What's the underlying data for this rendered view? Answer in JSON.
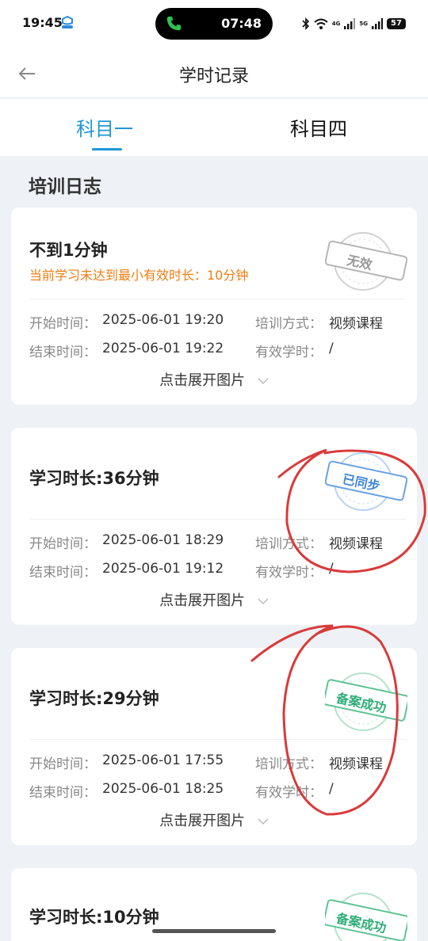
{
  "status_bar": {
    "time": "19:45",
    "call_timer": "07:48",
    "network_1": "4G",
    "network_2": "5G",
    "battery": "57"
  },
  "nav": {
    "title": "学时记录",
    "back_icon": "arrow-left-icon"
  },
  "tabs": [
    {
      "label": "科目一",
      "active": true
    },
    {
      "label": "科目四",
      "active": false
    }
  ],
  "section_title": "培训日志",
  "field_labels": {
    "start_time": "开始时间：",
    "end_time": "结束时间：",
    "training_mode": "培训方式：",
    "valid_hours": "有效学时："
  },
  "expand_label": "点击展开图片",
  "records": [
    {
      "title": "不到1分钟",
      "warning": "当前学习未达到最小有效时长：10分钟",
      "start_time": "2025-06-01 19:20",
      "end_time": "2025-06-01 19:22",
      "training_mode": "视频课程",
      "valid_hours": "/",
      "stamp": "无效",
      "stamp_color": "#9a9a9a"
    },
    {
      "title": "学习时长:36分钟",
      "start_time": "2025-06-01 18:29",
      "end_time": "2025-06-01 19:12",
      "training_mode": "视频课程",
      "valid_hours": "/",
      "stamp": "已同步",
      "stamp_color": "#3f86d8"
    },
    {
      "title": "学习时长:29分钟",
      "start_time": "2025-06-01 17:55",
      "end_time": "2025-06-01 18:25",
      "training_mode": "视频课程",
      "valid_hours": "/",
      "stamp": "备案成功",
      "stamp_color": "#2fae79"
    },
    {
      "title": "学习时长:10分钟",
      "stamp": "备案成功",
      "stamp_color": "#2fae79"
    }
  ],
  "colors": {
    "accent": "#2196d8",
    "warning": "#ef7d12",
    "annotation_red": "#d93a3a",
    "background": "#eef2f6"
  }
}
